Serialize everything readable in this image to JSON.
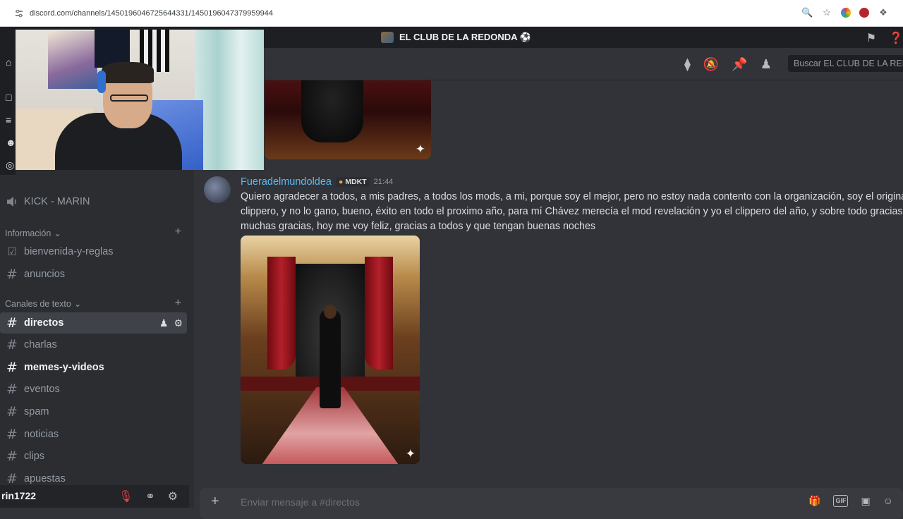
{
  "browser": {
    "url": "discord.com/channels/1450196046725644331/1450196047379959944"
  },
  "server": {
    "title": "EL CLUB DE LA REDONDA ⚽"
  },
  "search": {
    "placeholder": "Buscar EL CLUB DE LA REDONDA"
  },
  "sidebar": {
    "voice_channel": "KICK - MARIN",
    "categories": [
      {
        "label": "Información",
        "channels": [
          "bienvenida-y-reglas",
          "anuncios"
        ]
      },
      {
        "label": "Canales de texto",
        "channels": [
          "directos",
          "charlas",
          "memes-y-videos",
          "eventos",
          "spam",
          "noticias",
          "clips",
          "apuestas"
        ]
      }
    ],
    "active_channel": "directos",
    "unread_channels": [
      "memes-y-videos"
    ]
  },
  "user": {
    "name": "rin1722"
  },
  "message": {
    "author": "Fueradelmundoldea",
    "tag": "MDKT",
    "time": "21:44",
    "lines": [
      "Quiero agradecer a todos, a mis padres, a todos los mods, a mi, porque soy el mejor, pero no estoy nada contento con la organización, soy el original en",
      "clippero, y no lo gano, bueno, éxito en todo el proximo año, para mí Chávez merecía el mod revelación y yo el clippero del año, y sobre todo gracias a D",
      "muchas gracias, hoy me voy feliz,  gracias a todos y que tengan buenas noches"
    ]
  },
  "composer": {
    "placeholder": "Enviar mensaje a #directos",
    "gif_label": "GIF"
  },
  "colors": {
    "author": "#5bbaf0",
    "background": "#313338",
    "sidebar": "#2b2d31"
  }
}
